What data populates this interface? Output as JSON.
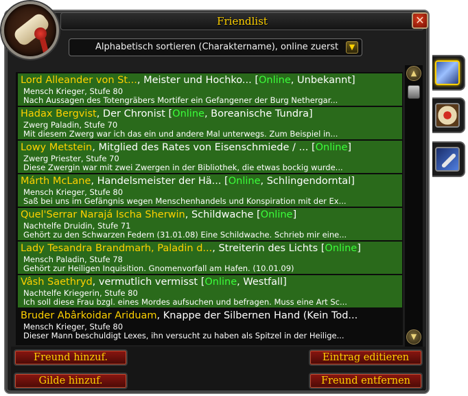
{
  "window": {
    "title": "Friendlist",
    "close_label": "✕"
  },
  "sort": {
    "selected": "Alphabetisch sortieren (Charaktername), online zuerst",
    "arrow": "▼"
  },
  "scrollbar": {
    "up": "▲",
    "down": "▼"
  },
  "tabs": [
    {
      "icon": "friends-book-icon",
      "active": true
    },
    {
      "icon": "guild-scroll-icon",
      "active": false
    },
    {
      "icon": "wrench-icon",
      "active": false
    }
  ],
  "friends": [
    {
      "name": "Lord Alleander von St...",
      "sep": ", ",
      "title": "Meister und Hochko...",
      "open": " [",
      "status": "Online",
      "rest": ", Unbekannt]",
      "info": "Mensch Krieger, Stufe 80",
      "note": "Nach Aussagen des Totengräbers Mortifer ein Gefangener der Burg Nethergar...",
      "online": true
    },
    {
      "name": "Hadax Bergvist",
      "sep": ", ",
      "title": "Der Chronist",
      "open": " [",
      "status": "Online",
      "rest": ", Boreanische Tundra]",
      "info": "Zwerg Paladin, Stufe 70",
      "note": "Mit diesem Zwerg war ich das ein und andere Mal unterwegs. Zum Beispiel in...",
      "online": true
    },
    {
      "name": "Lowy Metstein",
      "sep": ", ",
      "title": "Mitglied des Rates von Eisenschmiede / ...",
      "open": " [",
      "status": "Online",
      "rest": "]",
      "info": "Zwerg Priester, Stufe 70",
      "note": "Diese Zwergin war mit zwei Zwergen in der Bibliothek, die  etwas bockig wurde...",
      "online": true
    },
    {
      "name": "Márth McLane",
      "sep": ", ",
      "title": "Handelsmeister der Hä...",
      "open": " [",
      "status": "Online",
      "rest": ", Schlingendorntal]",
      "info": "Mensch Krieger, Stufe 80",
      "note": "Saß bei uns im Gefängnis wegen Menschenhandels und Konspiration mit der Ex...",
      "online": true
    },
    {
      "name": "Quel'Serrar Narajá Ischa Sherwin",
      "sep": ", ",
      "title": "Schildwache",
      "open": " [",
      "status": "Online",
      "rest": "]",
      "info": "Nachtelfe Druidin, Stufe 71",
      "note": "Gehört zu den Schwarzen Federn (31.01.08) Eine Schildwache. Schrieb mir eine...",
      "online": true
    },
    {
      "name": "Lady Tesandra Brandmarh, Paladin d...",
      "sep": ", ",
      "title": "Streiterin des Lichts",
      "open": " [",
      "status": "Online",
      "rest": "]",
      "info": "Mensch Paladin, Stufe 78",
      "note": "Gehört zur Heiligen Inquisition. Gnomenvorfall am Hafen. (10.01.09)",
      "online": true
    },
    {
      "name": "Vâsh Saethryd",
      "sep": ", ",
      "title": "vermutlich vermisst",
      "open": " [",
      "status": "Online",
      "rest": ", Westfall]",
      "info": "Nachtelfe Kriegerin, Stufe 80",
      "note": "Ich soll diese Frau bzgl. eines Mordes aufsuchen und befragen. Muss eine Art Sc...",
      "online": true
    },
    {
      "name": "Bruder Abârkoidar Ariduam",
      "sep": ", ",
      "title": "Knappe der Silbernen Hand (Kein Tod...",
      "open": "",
      "status": "",
      "rest": "",
      "info": "Mensch Krieger, Stufe 80",
      "note": "Dieser Mann beschuldigt Lexes, ihn versucht zu haben als Spitzel in der Heilige...",
      "online": false
    }
  ],
  "buttons": {
    "add_friend": "Freund hinzuf.",
    "add_guild": "Gilde hinzuf.",
    "edit_entry": "Eintrag editieren",
    "remove_friend": "Freund entfernen"
  },
  "colors": {
    "accent_gold": "#ffd100",
    "online_green": "#3bff3b",
    "online_row": "#2a6a1b",
    "button_red": "#8a1610"
  }
}
